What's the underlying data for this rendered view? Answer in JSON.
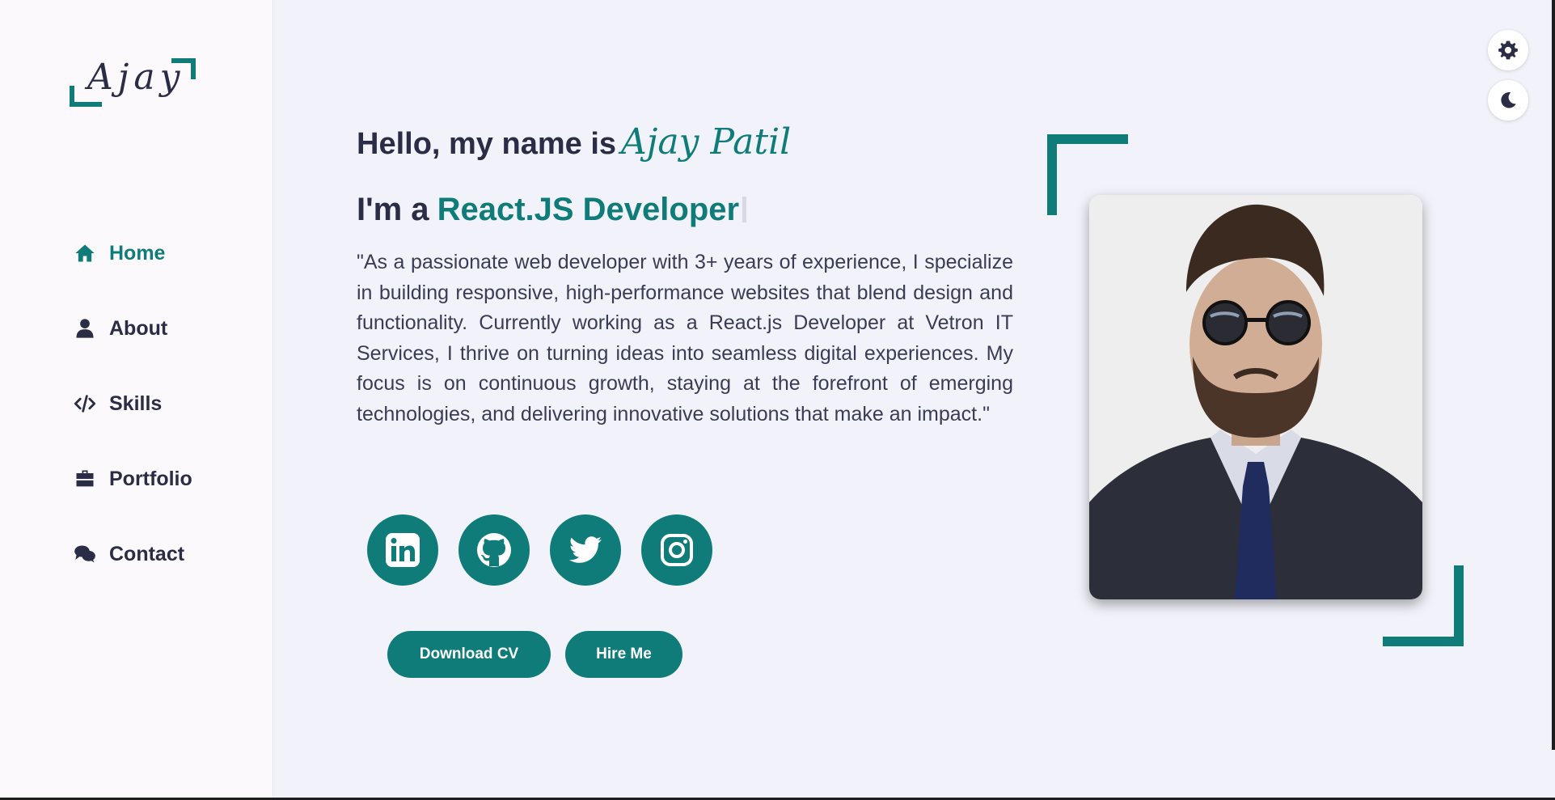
{
  "logo": {
    "text": "Ajay"
  },
  "nav": {
    "items": [
      {
        "label": "Home",
        "icon": "home-icon",
        "active": true
      },
      {
        "label": "About",
        "icon": "user-icon",
        "active": false
      },
      {
        "label": "Skills",
        "icon": "code-icon",
        "active": false
      },
      {
        "label": "Portfolio",
        "icon": "briefcase-icon",
        "active": false
      },
      {
        "label": "Contact",
        "icon": "comments-icon",
        "active": false
      }
    ]
  },
  "controls": {
    "settings_icon": "gear-icon",
    "theme_icon": "moon-icon"
  },
  "hero": {
    "greeting": "Hello, my name is",
    "name": "Ajay Patil",
    "role_prefix": "I'm a",
    "role": "React.JS Developer",
    "bio": "\"As a passionate web developer with 3+ years of experience, I specialize in building responsive, high-performance websites that blend design and functionality. Currently working as a React.js Developer at Vetron IT Services, I thrive on turning ideas into seamless digital experiences. My focus is on continuous growth, staying at the forefront of emerging technologies, and delivering innovative solutions that make an impact.\""
  },
  "socials": [
    {
      "icon": "linkedin-icon"
    },
    {
      "icon": "github-icon"
    },
    {
      "icon": "twitter-icon"
    },
    {
      "icon": "instagram-icon"
    }
  ],
  "buttons": {
    "download_cv": "Download CV",
    "hire_me": "Hire Me"
  },
  "colors": {
    "accent": "#0f7c7a",
    "text": "#2b2c45",
    "background": "#f2f3fa",
    "sidebar": "#fcf9fd"
  }
}
